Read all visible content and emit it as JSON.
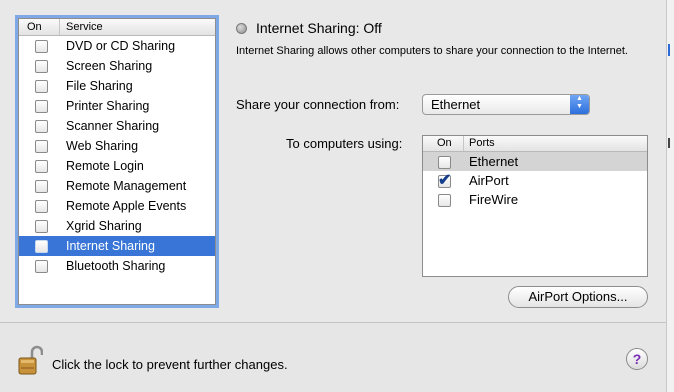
{
  "services": {
    "header_on": "On",
    "header_service": "Service",
    "items": [
      {
        "label": "DVD or CD Sharing",
        "checked": false,
        "selected": false
      },
      {
        "label": "Screen Sharing",
        "checked": false,
        "selected": false
      },
      {
        "label": "File Sharing",
        "checked": false,
        "selected": false
      },
      {
        "label": "Printer Sharing",
        "checked": false,
        "selected": false
      },
      {
        "label": "Scanner Sharing",
        "checked": false,
        "selected": false
      },
      {
        "label": "Web Sharing",
        "checked": false,
        "selected": false
      },
      {
        "label": "Remote Login",
        "checked": false,
        "selected": false
      },
      {
        "label": "Remote Management",
        "checked": false,
        "selected": false
      },
      {
        "label": "Remote Apple Events",
        "checked": false,
        "selected": false
      },
      {
        "label": "Xgrid Sharing",
        "checked": false,
        "selected": false
      },
      {
        "label": "Internet Sharing",
        "checked": false,
        "selected": true
      },
      {
        "label": "Bluetooth Sharing",
        "checked": false,
        "selected": false
      }
    ]
  },
  "detail": {
    "status": "Internet Sharing: Off",
    "description": "Internet Sharing allows other computers to share your connection to the Internet.",
    "share_from_label": "Share your connection from:",
    "share_from_value": "Ethernet",
    "to_computers_label": "To computers using:",
    "ports_header_on": "On",
    "ports_header_ports": "Ports",
    "ports": [
      {
        "label": "Ethernet",
        "checked": false,
        "highlighted": true
      },
      {
        "label": "AirPort",
        "checked": true,
        "highlighted": false
      },
      {
        "label": "FireWire",
        "checked": false,
        "highlighted": false
      }
    ],
    "airport_options_label": "AirPort Options..."
  },
  "footer": {
    "lock_text": "Click the lock to prevent further changes.",
    "help_label": "?"
  },
  "icons": {
    "status": "status-dot-icon",
    "lock": "unlocked-padlock-icon",
    "help": "help-icon",
    "popup": "up-down-arrows-icon",
    "check": "checkmark-icon"
  },
  "colors": {
    "selection": "#3875d7",
    "focus_ring": "#7fa8e6",
    "popup_arrows": "#2d6fdc",
    "help_glyph": "#7a2bb8"
  }
}
